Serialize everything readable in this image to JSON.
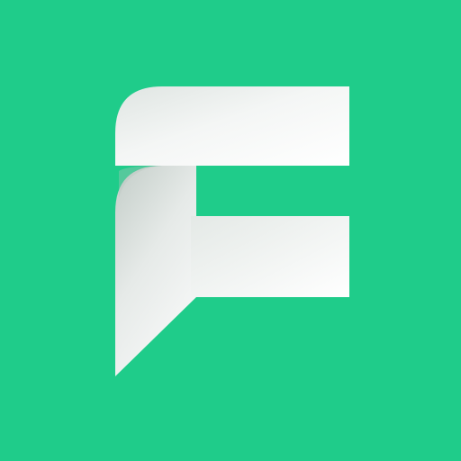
{
  "app_icon": {
    "logo_text": "F",
    "background_color": "#1fcc8a",
    "mark_light_color": "#ffffff",
    "mark_shadow_color": "#c9d3ce",
    "icon_name": "f-speech-bubble-logo-icon"
  }
}
